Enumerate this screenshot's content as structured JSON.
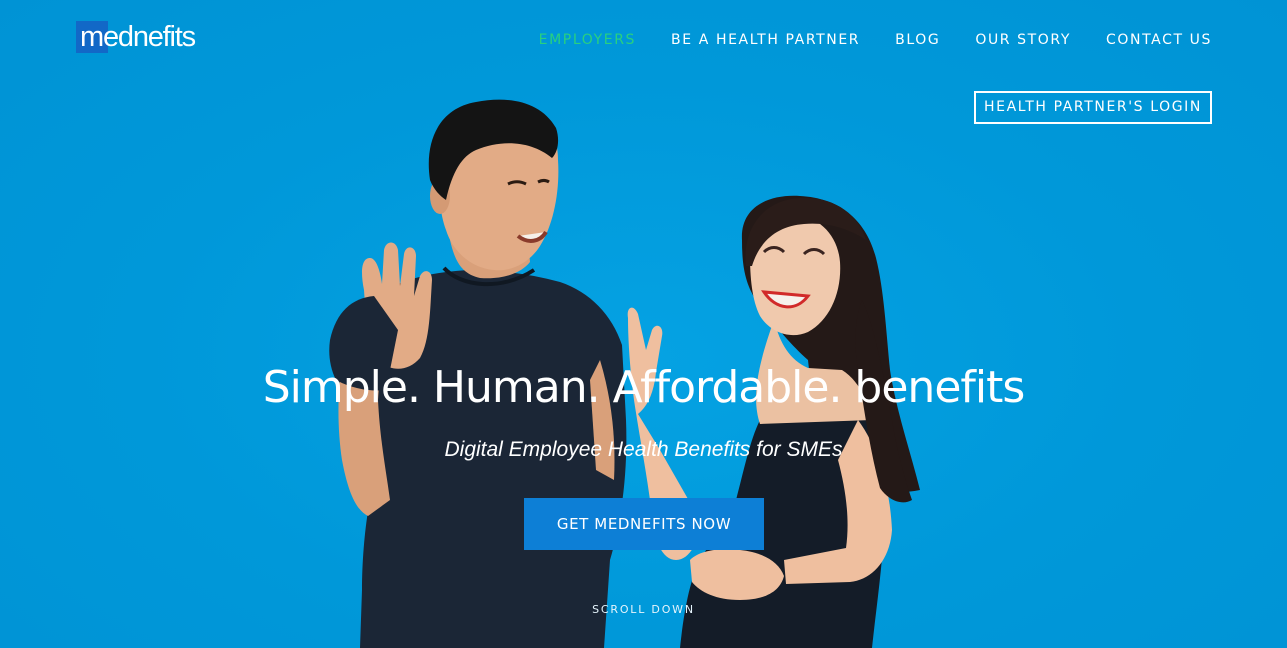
{
  "brand": {
    "name": "mednefits",
    "primary_color": "#0097d8",
    "accent_color": "#29d07f",
    "logo_square_color": "#1268c7",
    "cta_color": "#0d7fd6"
  },
  "nav": {
    "items": [
      {
        "label": "EMPLOYERS",
        "active": true
      },
      {
        "label": "BE A HEALTH PARTNER",
        "active": false
      },
      {
        "label": "BLOG",
        "active": false
      },
      {
        "label": "OUR STORY",
        "active": false
      },
      {
        "label": "CONTACT US",
        "active": false
      }
    ],
    "login_label": "HEALTH PARTNER'S LOGIN"
  },
  "hero": {
    "title": "Simple. Human. Affordable. benefits",
    "subtitle": "Digital Employee Health Benefits for SMEs",
    "cta_label": "GET MEDNEFITS NOW",
    "scroll_label": "SCROLL DOWN"
  }
}
